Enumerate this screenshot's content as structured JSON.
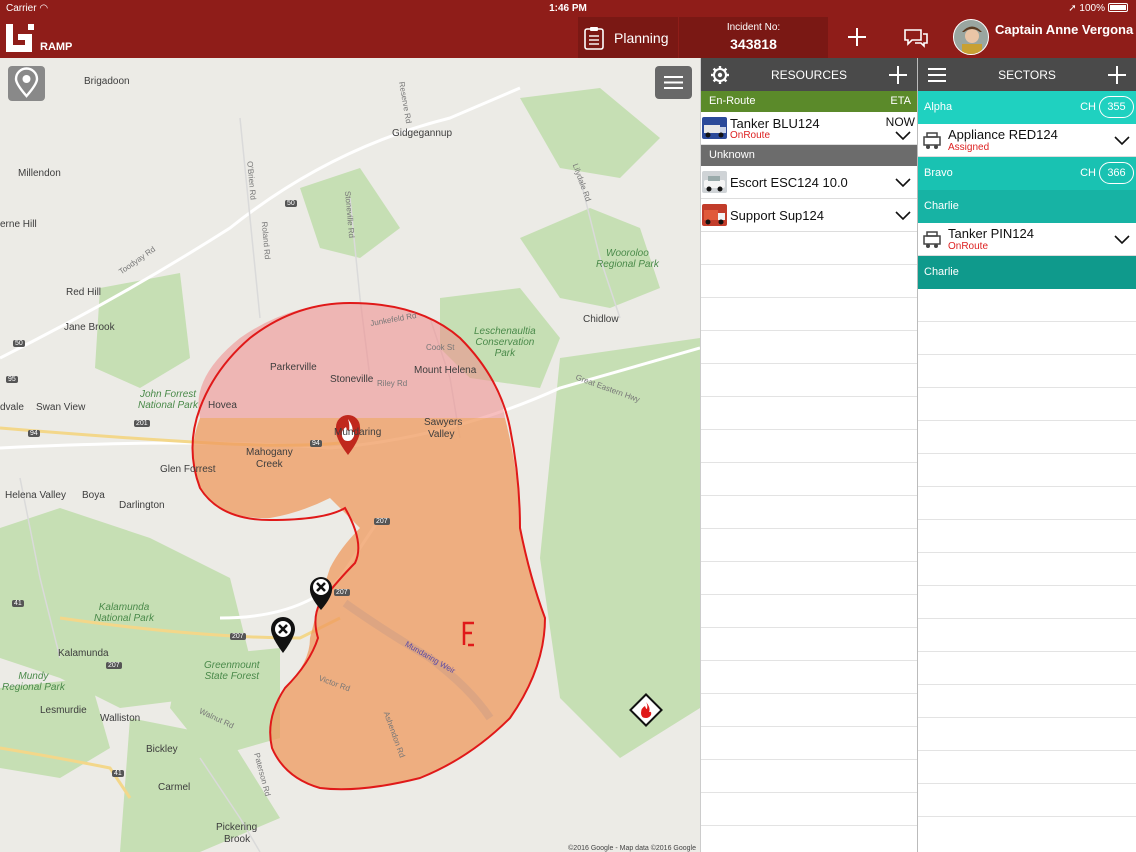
{
  "status_bar": {
    "carrier": "Carrier",
    "time": "1:46 PM",
    "battery": "100%"
  },
  "app": {
    "logo_text": "RAMP"
  },
  "header": {
    "planning_label": "Planning",
    "incident_label": "Incident No:",
    "incident_number": "343818",
    "user_name": "Captain Anne Vergona"
  },
  "map": {
    "places": [
      {
        "name": "Brigadoon"
      },
      {
        "name": "Millendon"
      },
      {
        "name": "Gidgegannup"
      },
      {
        "name": "erne Hill"
      },
      {
        "name": "Red Hill"
      },
      {
        "name": "Jane Brook"
      },
      {
        "name": "Chidlow"
      },
      {
        "name": "Parkerville"
      },
      {
        "name": "Stoneville"
      },
      {
        "name": "Mount Helena"
      },
      {
        "name": "Hovea"
      },
      {
        "name": "Swan View"
      },
      {
        "name": "dvale"
      },
      {
        "name": "Sawyers"
      },
      {
        "name": "Valley"
      },
      {
        "name": "Mahogany"
      },
      {
        "name": "Creek"
      },
      {
        "name": "Glen Forrest"
      },
      {
        "name": "Helena Valley"
      },
      {
        "name": "Boya"
      },
      {
        "name": "Darlington"
      },
      {
        "name": "Kalamunda"
      },
      {
        "name": "Lesmurdie"
      },
      {
        "name": "Walliston"
      },
      {
        "name": "Bickley"
      },
      {
        "name": "Carmel"
      },
      {
        "name": "Pickering"
      },
      {
        "name": "Brook"
      },
      {
        "name": "Mundaring"
      }
    ],
    "parks": [
      {
        "name": "Wooroloo\nRegional Park"
      },
      {
        "name": "Leschenaultia\nConservation\nPark"
      },
      {
        "name": "John Forrest\nNational Park"
      },
      {
        "name": "Kalamunda\nNational Park"
      },
      {
        "name": "Greenmount\nState Forest"
      },
      {
        "name": "Mundy\nRegional Park"
      }
    ],
    "roads": [
      {
        "name": "Toodyay Rd"
      },
      {
        "name": "Great Eastern Hwy"
      },
      {
        "name": "Reserve Rd"
      },
      {
        "name": "O'Brien Rd"
      },
      {
        "name": "Roland Rd"
      },
      {
        "name": "Stoneville Rd"
      },
      {
        "name": "Lilydale Rd"
      },
      {
        "name": "Junkefeld Rd"
      },
      {
        "name": "Riley Rd"
      },
      {
        "name": "Cook St"
      },
      {
        "name": "Mundaring Weir"
      },
      {
        "name": "Ashendon Rd"
      },
      {
        "name": "Walnut Rd"
      },
      {
        "name": "Paterson Rd"
      },
      {
        "name": "Victor Rd"
      }
    ],
    "shields": [
      "50",
      "50",
      "95",
      "201",
      "94",
      "94",
      "207",
      "207",
      "207",
      "207",
      "41",
      "41"
    ],
    "attribution": "©2016 Google - Map data ©2016 Google",
    "colors": {
      "fire_zone_red": "#f08a8a",
      "fire_zone_orange": "#ef9a5e",
      "fire_outline": "#e01919"
    }
  },
  "resources": {
    "title": "RESOURCES",
    "groups": [
      {
        "label": "En-Route",
        "eta_label": "ETA",
        "items": [
          {
            "name": "Tanker BLU124",
            "status": "OnRoute",
            "eta": "NOW",
            "vehicle_color": "#2b4a9a"
          }
        ]
      },
      {
        "label": "Unknown",
        "items": [
          {
            "name": "Escort ESC124 10.0",
            "vehicle_color": "#e8e8e8"
          },
          {
            "name": "Support Sup124",
            "vehicle_color": "#c23c2a"
          }
        ]
      }
    ]
  },
  "sectors": {
    "title": "SECTORS",
    "list": [
      {
        "label": "Alpha",
        "ch_label": "CH",
        "ch_number": "355",
        "items": [
          {
            "name": "Appliance RED124",
            "status": "Assigned"
          }
        ]
      },
      {
        "label": "Bravo",
        "ch_label": "CH",
        "ch_number": "366",
        "items": []
      },
      {
        "label": "Charlie",
        "items": [
          {
            "name": "Tanker PIN124",
            "status": "OnRoute"
          }
        ]
      },
      {
        "label": "Charlie",
        "items": []
      }
    ]
  }
}
